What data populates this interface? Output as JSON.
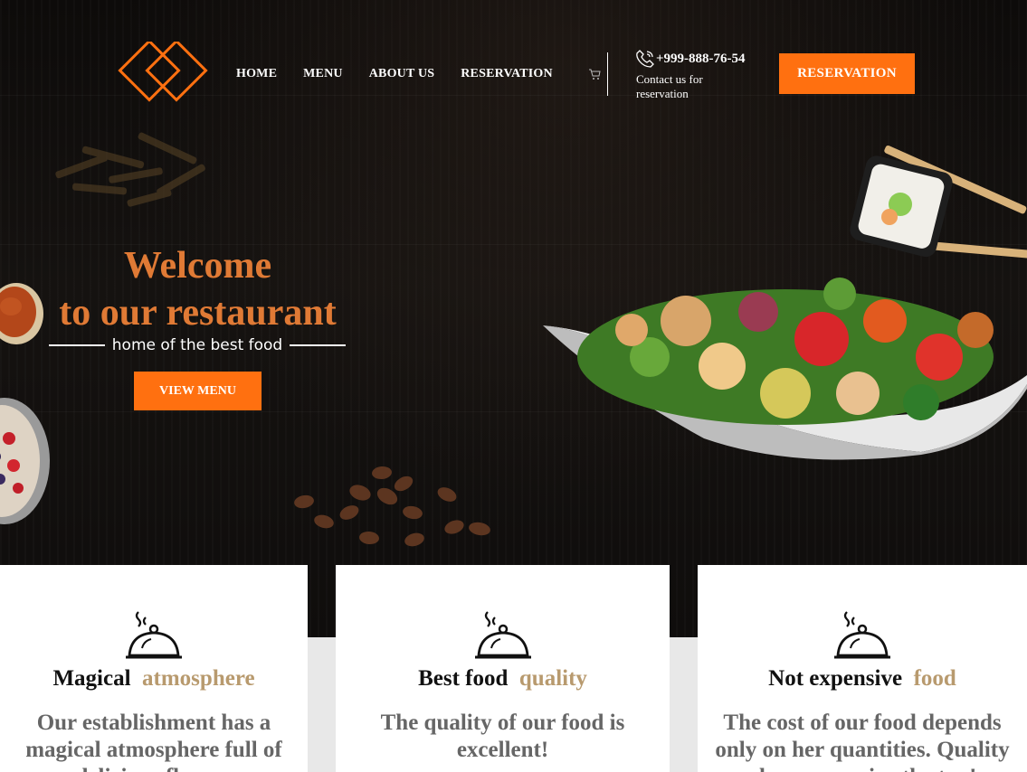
{
  "nav": {
    "items": [
      "HOME",
      "MENU",
      "ABOUT US",
      "RESERVATION"
    ]
  },
  "header": {
    "phone": "+999-888-76-54",
    "contact_text": "Contact us for reservation",
    "reservation_button": "RESERVATION"
  },
  "hero": {
    "title_line1": "Welcome",
    "title_line2": "to our restaurant",
    "subtitle": "home of the best food",
    "button": "VIEW MENU"
  },
  "cards": [
    {
      "title": "Magical",
      "highlight": "atmosphere",
      "text": "Our establishment has a magical atmosphere full of delicious flavors"
    },
    {
      "title": "Best food",
      "highlight": "quality",
      "text": "The quality of our food is excellent!"
    },
    {
      "title": "Not expensive",
      "highlight": "food",
      "text": "The cost of our food depends only on her quantities. Quality always remains the top!"
    }
  ],
  "colors": {
    "accent": "#ff7010",
    "title": "#e07a35",
    "highlight": "#b89a6e",
    "background": "#0f0d0c"
  },
  "icons": [
    "logo-diamonds-icon",
    "cart-icon",
    "phone-icon",
    "cloche-icon"
  ]
}
